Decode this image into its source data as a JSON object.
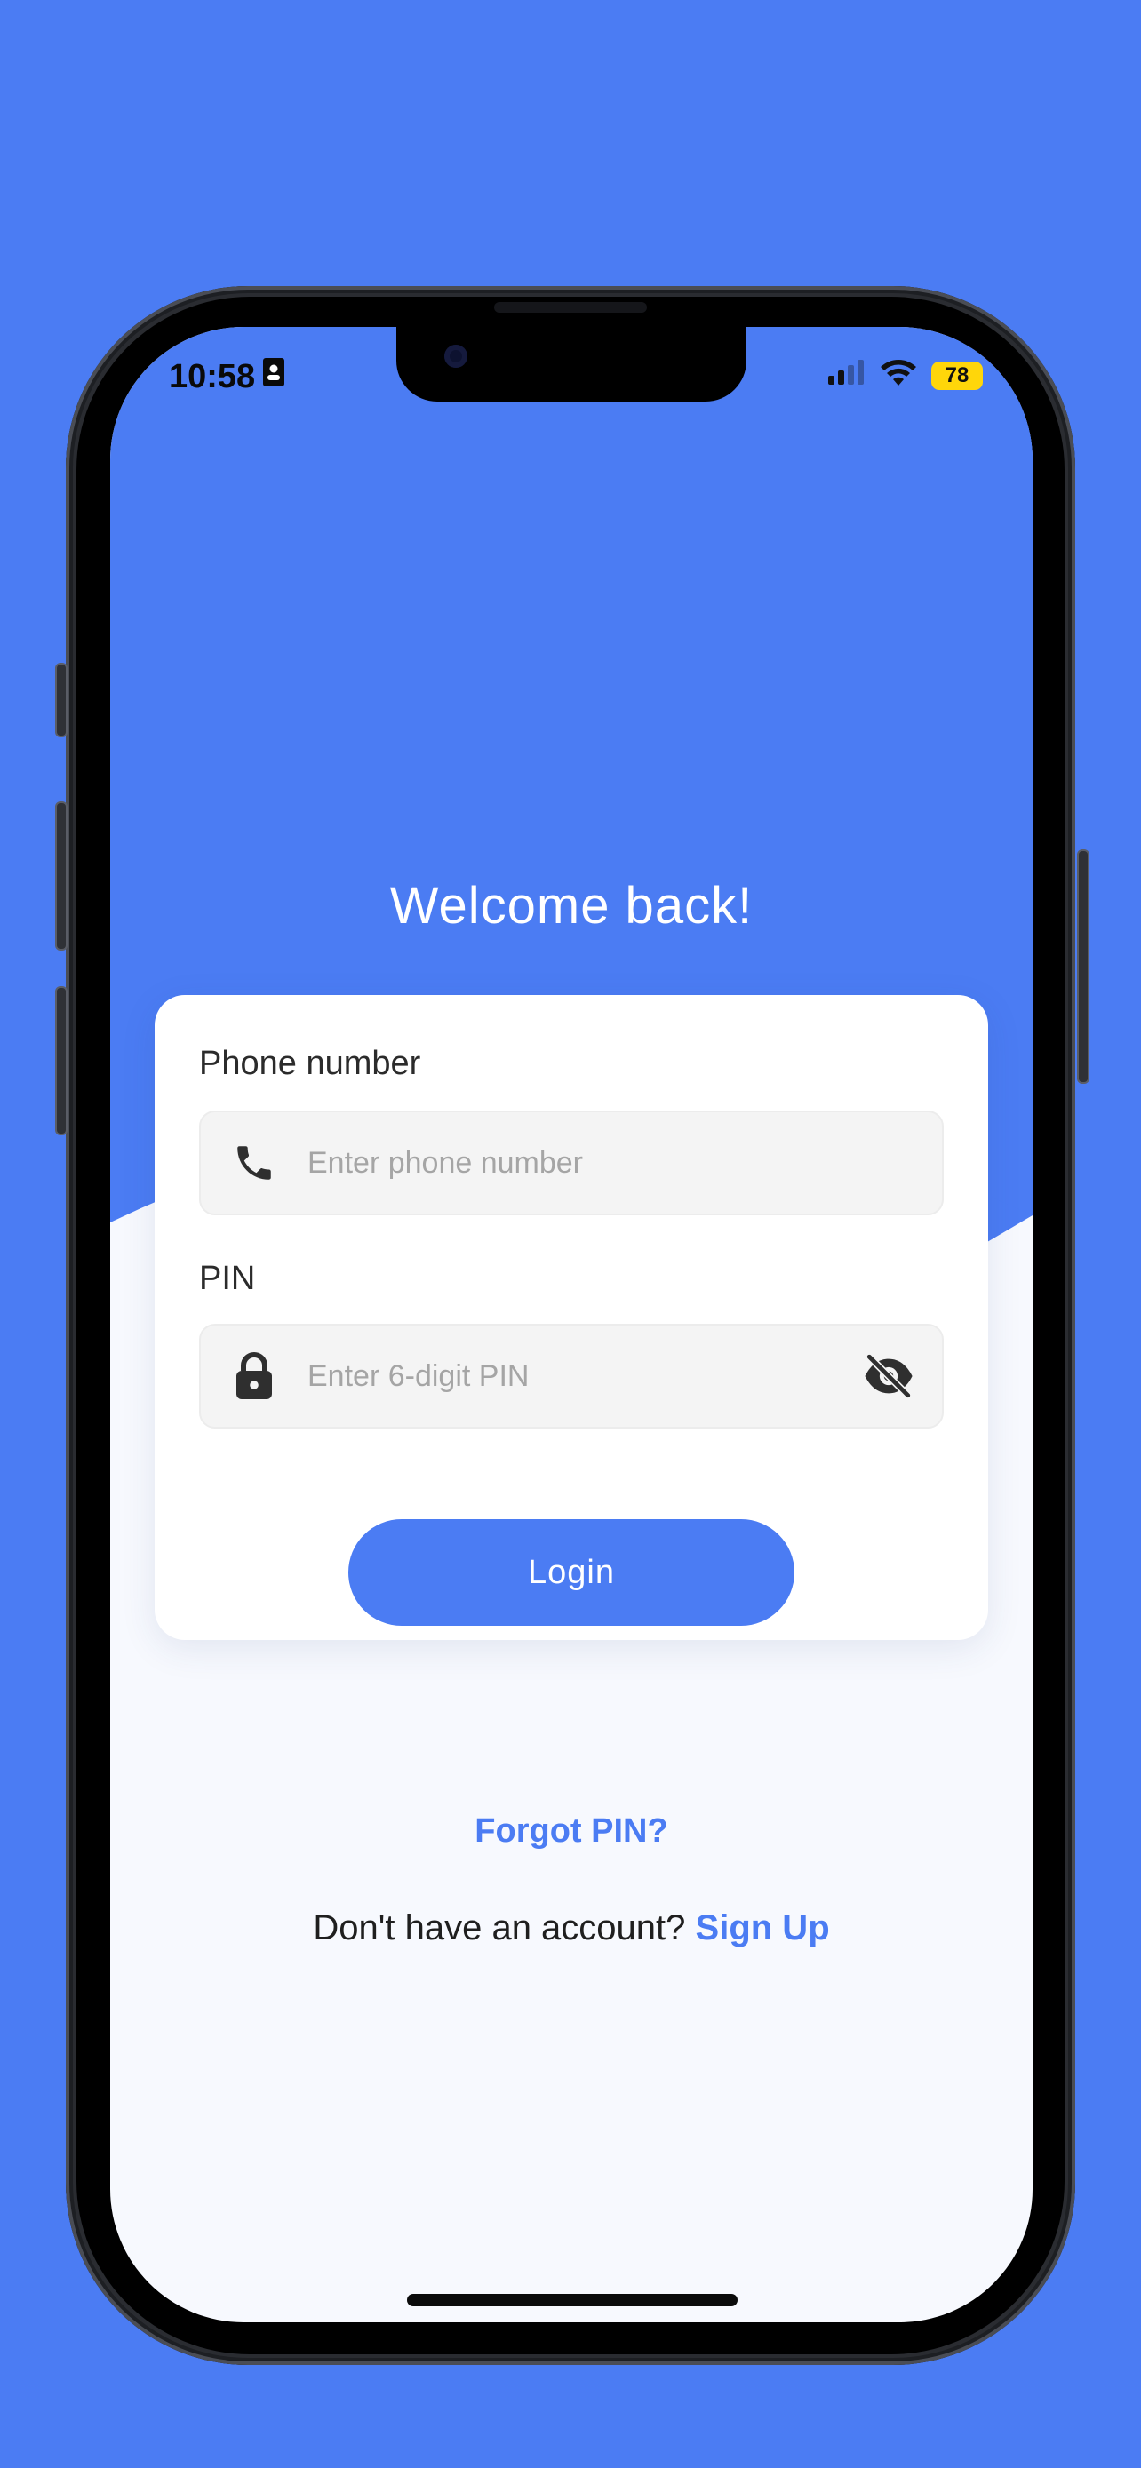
{
  "status_bar": {
    "time": "10:58",
    "battery_level": "78",
    "id_icon": "contact-card-icon",
    "signal_icon": "cellular-signal-icon",
    "wifi_icon": "wifi-icon"
  },
  "screen": {
    "title": "Welcome back!"
  },
  "form": {
    "phone_label": "Phone number",
    "phone_placeholder": "Enter phone number",
    "phone_icon": "phone-icon",
    "pin_label": "PIN",
    "pin_placeholder": "Enter 6-digit PIN",
    "pin_icon": "lock-icon",
    "visibility_icon": "eye-off-icon",
    "login_label": "Login"
  },
  "links": {
    "forgot": "Forgot PIN?",
    "signup_prompt": "Don't have an account?",
    "signup": "Sign Up"
  },
  "colors": {
    "accent": "#4b7cf3",
    "card": "#ffffff",
    "input_bg": "#f4f4f4",
    "screen_bg": "#f7f9fe",
    "battery": "#ffd60a"
  }
}
